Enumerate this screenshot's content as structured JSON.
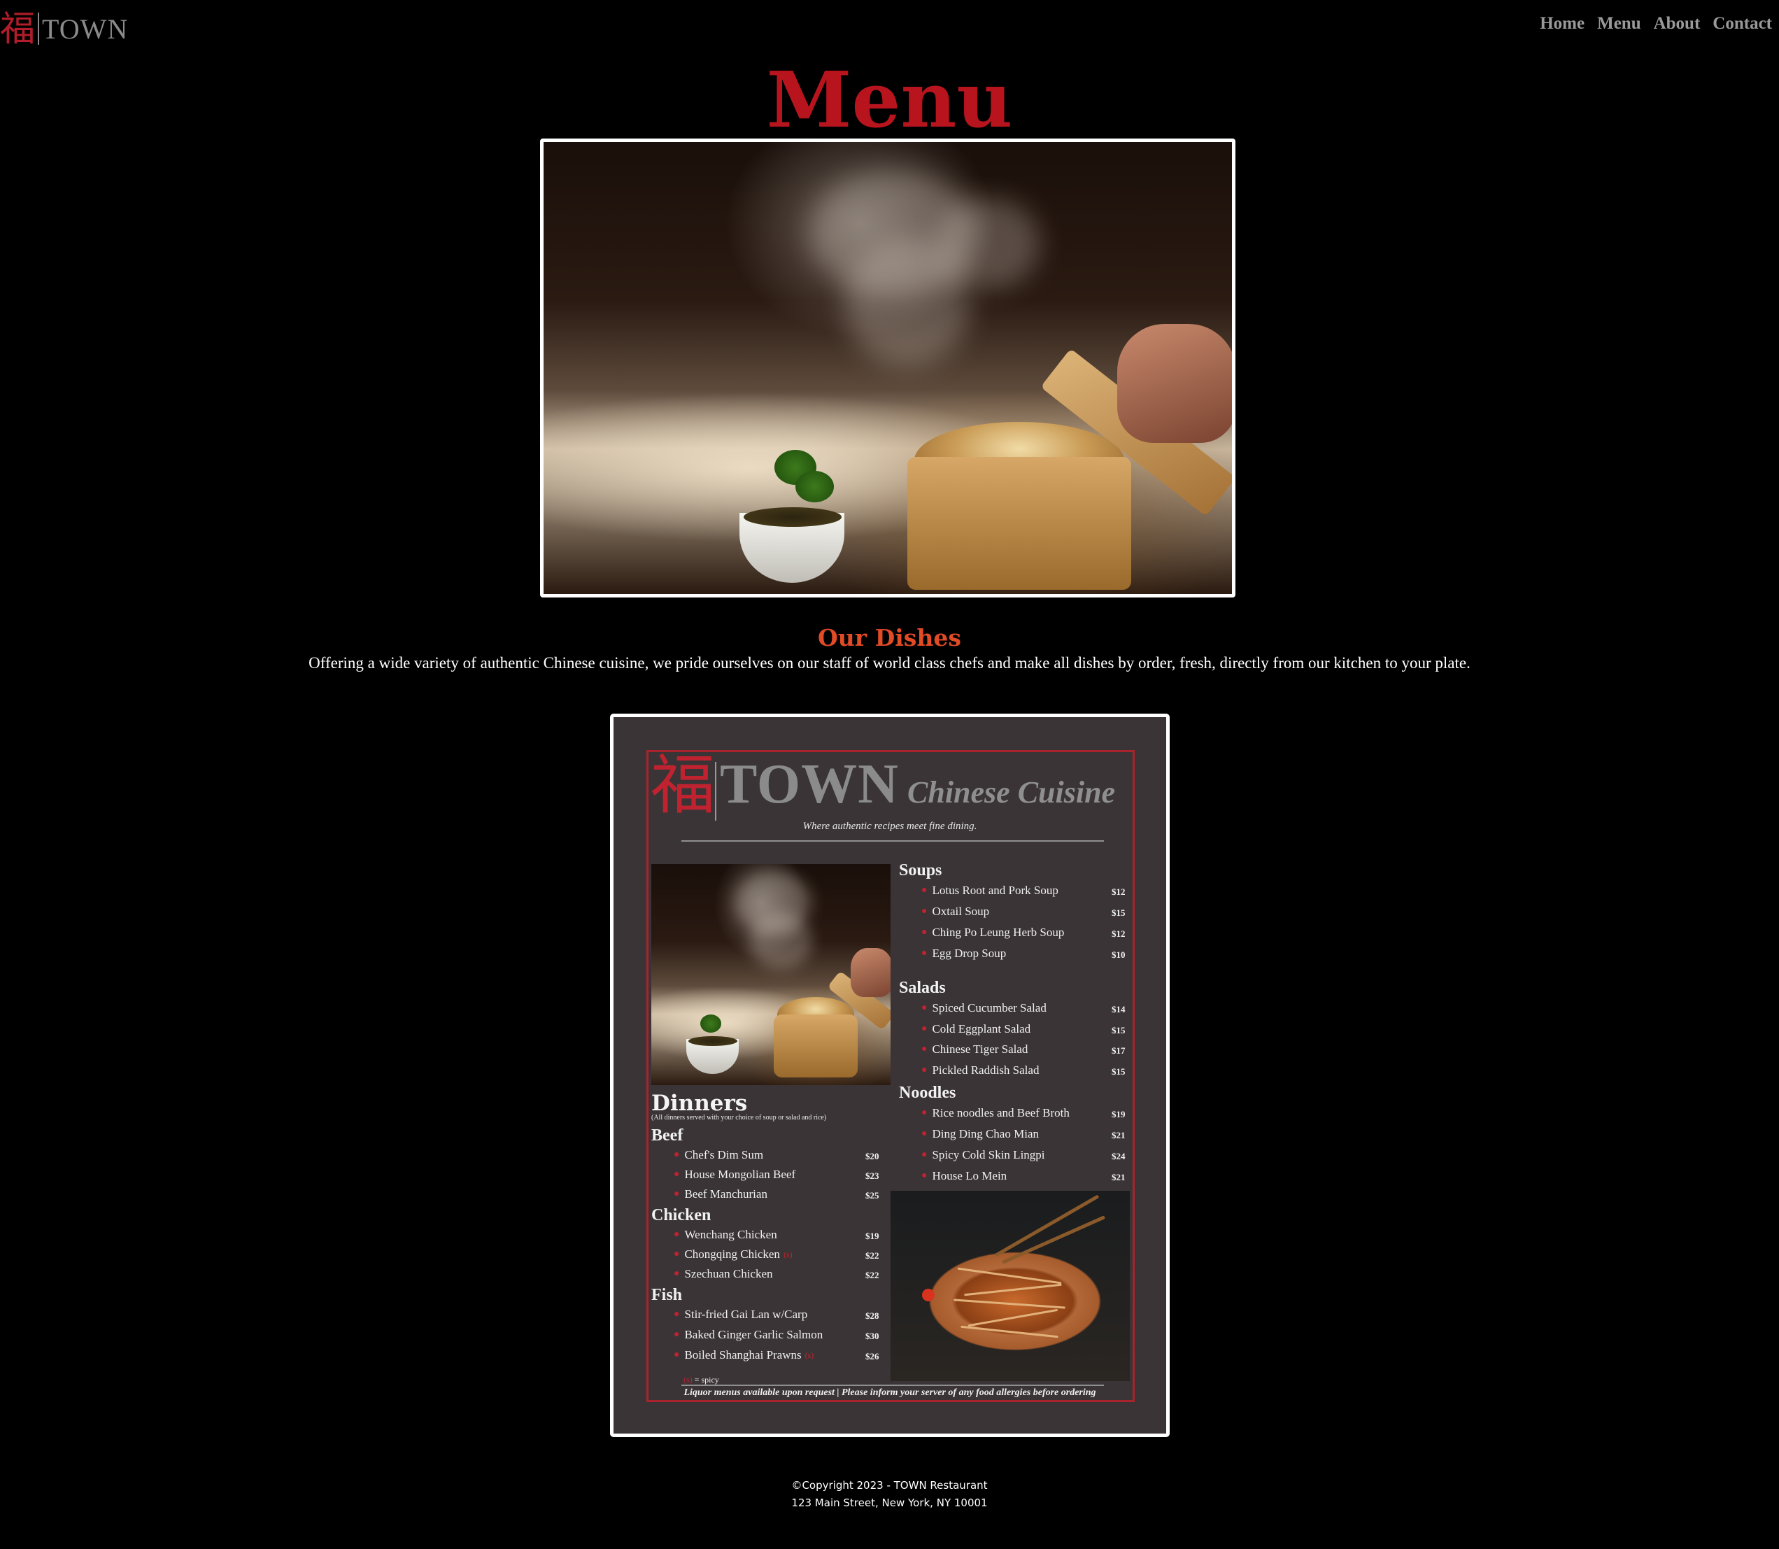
{
  "nav": {
    "logo_glyph": "福",
    "logo_text": "TOWN",
    "links": [
      "Home",
      "Menu",
      "About",
      "Contact"
    ]
  },
  "page_title": "Menu",
  "dishes": {
    "title": "Our Dishes",
    "text": "Offering a wide variety of authentic Chinese cuisine, we pride ourselves on our staff of world class chefs and make all dishes by order, fresh, directly from our kitchen to your plate."
  },
  "menu_card": {
    "glyph": "福",
    "brand": "TOWN",
    "cuisine": "Chinese Cuisine",
    "tagline": "Where authentic recipes meet fine dining.",
    "dinners_title": "Dinners",
    "dinners_note": "(All dinners served with your choice of soup or salad and rice)",
    "sections": [
      {
        "name": "Soups",
        "items": [
          {
            "name": "Lotus Root and Pork  Soup",
            "price": "$12"
          },
          {
            "name": "Oxtail Soup",
            "price": "$15"
          },
          {
            "name": "Ching Po Leung Herb Soup",
            "price": "$12"
          },
          {
            "name": "Egg Drop Soup",
            "price": "$10"
          }
        ]
      },
      {
        "name": "Salads",
        "items": [
          {
            "name": "Spiced Cucumber Salad",
            "price": "$14"
          },
          {
            "name": "Cold Eggplant Salad",
            "price": "$15"
          },
          {
            "name": "Chinese Tiger Salad",
            "price": "$17"
          },
          {
            "name": "Pickled Raddish Salad",
            "price": "$15"
          }
        ]
      },
      {
        "name": "Noodles",
        "items": [
          {
            "name": "Rice noodles and Beef Broth",
            "price": "$19"
          },
          {
            "name": "Ding Ding Chao Mian",
            "price": "$21"
          },
          {
            "name": "Spicy Cold Skin Lingpi",
            "price": "$24"
          },
          {
            "name": "House Lo Mein",
            "price": "$21"
          }
        ]
      },
      {
        "name": "Beef",
        "items": [
          {
            "name": "Chef's Dim Sum",
            "price": "$20"
          },
          {
            "name": "House Mongolian Beef",
            "price": "$23"
          },
          {
            "name": "Beef Manchurian",
            "price": "$25"
          }
        ]
      },
      {
        "name": "Chicken",
        "items": [
          {
            "name": "Wenchang Chicken",
            "price": "$19"
          },
          {
            "name": "Chongqing Chicken",
            "spicy": "(s)",
            "price": "$22"
          },
          {
            "name": "Szechuan Chicken",
            "price": "$22"
          }
        ]
      },
      {
        "name": "Fish",
        "items": [
          {
            "name": "Stir-fried Gai Lan w/Carp",
            "price": "$28"
          },
          {
            "name": "Baked Ginger Garlic Salmon",
            "price": "$30"
          },
          {
            "name": "Boiled Shanghai Prawns",
            "spicy": "(s)",
            "price": "$26"
          }
        ]
      }
    ],
    "legend_symbol": "(s)",
    "legend_text": " = spicy",
    "footnote": "Liquor menus available upon request | Please inform your server of any food allergies before ordering"
  },
  "footer": {
    "copyright": "©Copyright 2023 - TOWN Restaurant",
    "address": "123 Main Street, New York, NY 10001"
  }
}
